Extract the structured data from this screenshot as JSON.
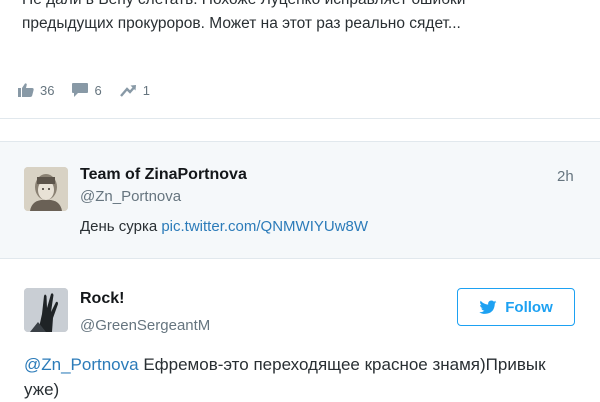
{
  "top_tweet": {
    "line1": "Не дали в Вену слетать. Похоже Луценко исправляет ошибки",
    "line2": "предыдущих прокуроров. Может на этот раз реально сядет...",
    "actions": {
      "reply_count": "36",
      "comment_count": "6",
      "share_count": "1"
    }
  },
  "tweet2": {
    "name": "Team of ZinaPortnova",
    "handle": "@Zn_Portnova",
    "time": "2h",
    "text": "День сурка ",
    "link": "pic.twitter.com/QNMWIYUw8W"
  },
  "tweet3": {
    "name": "Rock!",
    "handle": "@GreenSergeantM",
    "follow_label": "Follow",
    "mention": "@Zn_Portnova",
    "text": " Ефремов-это переходящее красное знамя)Привык уже)"
  },
  "colors": {
    "accent": "#1da1f2",
    "link": "#2b7bb9",
    "muted": "#66757f",
    "highlight_bg": "#f5f8fa"
  }
}
